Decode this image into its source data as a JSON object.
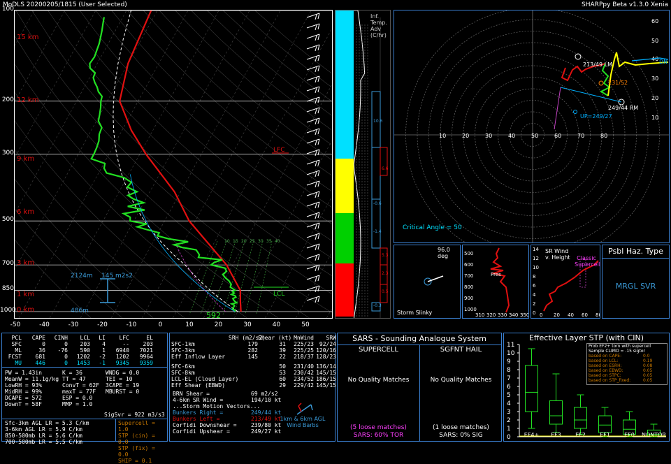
{
  "header": {
    "left": "MoDLS   20200205/1815  (User Selected)",
    "right": "SHARPpy Beta v1.3.0 Xenia"
  },
  "skewt": {
    "pressure_labels": [
      "100",
      "200",
      "300",
      "500",
      "700",
      "850",
      "1000"
    ],
    "height_labels": [
      "15 km",
      "12 km",
      "9 km",
      "6 km",
      "3 km",
      "1 km",
      "0 km"
    ],
    "temp_labels": [
      "-50",
      "-40",
      "-30",
      "-20",
      "-10",
      "0",
      "10",
      "20",
      "30",
      "40",
      "50"
    ],
    "lfc_label": "LFC",
    "lcl_label": "LCL",
    "srh_label": "145 m2s2",
    "height_a": "2124m",
    "height_b": "486m",
    "sfc_temp": "592",
    "hodo_mini_labels": [
      "10",
      "15",
      "20",
      "25",
      "30",
      "35",
      "40"
    ]
  },
  "adv": {
    "title": "Inf. Temp. Adv (C/hr)",
    "values": [
      "10.6",
      "-0.6",
      "-1.4",
      "5.3",
      "2.3",
      "0.5",
      "-0.3"
    ],
    "blue_values": [
      "10.6",
      "-0.6",
      "-1.4",
      "-0.3"
    ],
    "red_values": [
      "6.6",
      "5.3",
      "2.3",
      "0.5"
    ]
  },
  "hodograph": {
    "axis_labels": [
      "10",
      "20",
      "30",
      "40",
      "50",
      "60",
      "70",
      "80"
    ],
    "y_labels": [
      "60",
      "50",
      "40",
      "30",
      "20",
      "10"
    ],
    "lm_label": "213/49 LM",
    "rm_label": "249/44 RM",
    "up_label": "UP=249/27",
    "dn_label": "DN",
    "mw_label": "231/52",
    "critical_angle": "Critical Angle = 50"
  },
  "slinky": {
    "title": "Storm Slinky",
    "deg": "96.0 deg"
  },
  "theta": {
    "xlabels": [
      "310",
      "320",
      "330",
      "340",
      "350"
    ],
    "ylabels": [
      "500",
      "600",
      "700",
      "800",
      "900",
      "1000"
    ],
    "label": "Pres"
  },
  "srwind": {
    "title": "SR Wind v. Height",
    "classic": "Classic Supercell",
    "xlabels": [
      "0",
      "20",
      "40",
      "60",
      "80"
    ],
    "ylabels": [
      "14",
      "12",
      "10",
      "8",
      "6",
      "4",
      "2",
      "0"
    ]
  },
  "hazard": {
    "title": "Psbl Haz. Type",
    "value": "MRGL SVR"
  },
  "parcel_table": {
    "headers": [
      "PCL",
      "CAPE",
      "CINH",
      "LCL",
      "LI",
      "LFC",
      "EL"
    ],
    "rows": [
      [
        "SFC",
        "0",
        "0",
        "203",
        "4",
        "--",
        "203"
      ],
      [
        "ML",
        "36",
        "-76",
        "590",
        "1",
        "6940",
        "7021"
      ],
      [
        "FCST",
        "681",
        "0",
        "1202",
        "-2",
        "1202",
        "9964"
      ],
      [
        "MU",
        "446",
        "0",
        "1453",
        "-1",
        "9345",
        "9359"
      ]
    ]
  },
  "thermo": {
    "left": [
      "PW = 1.43in",
      "MeanW = 11.1g/kg",
      "LowRH = 93%",
      "MidRH = 99%",
      "DCAPE = 572",
      "DownT = 58F"
    ],
    "right": [
      "K = 36",
      "TT = 47",
      "ConvT = 62F",
      "maxT = 77F",
      "ESP = 0.0",
      "MMP = 1.0"
    ],
    "right2": [
      "WNDG = 0.0",
      "TEI = 10",
      "3CAPE = 19",
      "MBURST = 0",
      "",
      ""
    ],
    "sigsvr": "SigSvr = 922 m3/s3",
    "lapse": [
      "Sfc-3km AGL LR = 5.3 C/km",
      "3-6km AGL LR = 5.9 C/km",
      "850-500mb LR = 5.6 C/km",
      "700-500mb LR = 5.5 C/km"
    ],
    "composite": [
      "Supercell = 1.0",
      "STP (cin) = 0.0",
      "STP (fix) = 0.0",
      "SHIP = 0.1"
    ]
  },
  "kinematic": {
    "headers": [
      "",
      "SRH (m2/s2)",
      "Shear (kt)",
      "MnWind",
      "SRW"
    ],
    "rows": [
      [
        "SFC-1km",
        "179",
        "31",
        "225/23",
        "92/24"
      ],
      [
        "SFC-3km",
        "282",
        "39",
        "225/25",
        "120/16"
      ],
      [
        "Eff Inflow Layer",
        "145",
        "22",
        "218/37",
        "128/23"
      ],
      [
        "SFC-6km",
        "",
        "50",
        "231/40",
        "136/14"
      ],
      [
        "SFC-8km",
        "",
        "53",
        "230/42",
        "145/15"
      ],
      [
        "LCL-EL (Cloud Layer)",
        "",
        "60",
        "234/52",
        "186/15"
      ],
      [
        "Eff Shear (EBWD)",
        "",
        "29",
        "229/42",
        "145/15"
      ]
    ],
    "brn_shear": "BRN Shear =",
    "brn_value": "69 m2/s2",
    "sr46": "4-6km SR Wind =",
    "sr46_value": "194/10 kt",
    "motion_title": "...Storm Motion Vectors...",
    "motions": [
      [
        "Bunkers Right =",
        "249/44 kt"
      ],
      [
        "Bunkers Left =",
        "213/49 kt"
      ],
      [
        "Corfidi Downshear =",
        "239/80 kt"
      ],
      [
        "Corfidi Upshear =",
        "249/27 kt"
      ]
    ],
    "barb_legend": "1km & 6km AGL Wind Barbs"
  },
  "sars": {
    "title": "SARS - Sounding Analogue System",
    "supercell": "SUPERCELL",
    "hail": "SGFNT HAIL",
    "no_match_1": "No Quality Matches",
    "no_match_2": "No Quality Matches",
    "loose_1": "(5 loose matches)",
    "loose_1b": "SARS: 60% TOR",
    "loose_2": "(1 loose matches)",
    "loose_2b": "SARS: 0% SIG"
  },
  "stp": {
    "title": "Effective Layer STP (with CIN)",
    "legend_title": "Prob EF2+ torn with supercell",
    "legend_sub": "Sample CLIMO = .15 sigtor",
    "legend_rows": [
      [
        "based on CAPE:",
        "0.0"
      ],
      [
        "based on LCL:",
        "0.19"
      ],
      [
        "based on ESRH:",
        "0.08"
      ],
      [
        "based on EBWD:",
        "0.05"
      ],
      [
        "based on STPC:",
        "0.05"
      ],
      [
        "based on STP_fixed:",
        "0.05"
      ]
    ],
    "y_ticks": [
      "11",
      "10",
      "9",
      "8",
      "7",
      "6",
      "5",
      "4",
      "3",
      "2",
      "1",
      "0"
    ],
    "categories": [
      "EF4+",
      "EF3",
      "EF2",
      "EF1",
      "EF0",
      "NONTOR"
    ]
  },
  "chart_data": {
    "type": "box",
    "title": "Effective Layer STP (with CIN)",
    "categories": [
      "EF4+",
      "EF3",
      "EF2",
      "EF1",
      "EF0",
      "NONTOR"
    ],
    "boxes": [
      {
        "low": 1.0,
        "q1": 3.0,
        "median": 5.3,
        "q3": 8.5,
        "high": 10.5
      },
      {
        "low": 0.5,
        "q1": 1.5,
        "median": 2.5,
        "q3": 4.3,
        "high": 7.5
      },
      {
        "low": 0.3,
        "q1": 1.0,
        "median": 2.0,
        "q3": 3.5,
        "high": 5.0
      },
      {
        "low": 0.0,
        "q1": 0.5,
        "median": 1.4,
        "q3": 2.5,
        "high": 3.5
      },
      {
        "low": 0.0,
        "q1": 0.3,
        "median": 0.9,
        "q3": 2.0,
        "high": 3.0
      },
      {
        "low": 0.0,
        "q1": 0.1,
        "median": 0.3,
        "q3": 0.8,
        "high": 1.5
      }
    ],
    "ylim": [
      0,
      11
    ],
    "current_value": 0.0,
    "skewt_temperature_C": [
      {
        "p": 1000,
        "t": 21
      },
      {
        "p": 925,
        "t": 19
      },
      {
        "p": 850,
        "t": 17
      },
      {
        "p": 700,
        "t": 8
      },
      {
        "p": 500,
        "t": -12
      },
      {
        "p": 400,
        "t": -22
      },
      {
        "p": 300,
        "t": -38
      },
      {
        "p": 250,
        "t": -47
      },
      {
        "p": 200,
        "t": -56
      },
      {
        "p": 150,
        "t": -60
      },
      {
        "p": 100,
        "t": -62
      }
    ],
    "skewt_dewpoint_C": [
      {
        "p": 1000,
        "t": 19
      },
      {
        "p": 925,
        "t": 17
      },
      {
        "p": 850,
        "t": 15
      },
      {
        "p": 700,
        "t": 6
      },
      {
        "p": 600,
        "t": -10
      },
      {
        "p": 500,
        "t": -30
      },
      {
        "p": 400,
        "t": -35
      },
      {
        "p": 300,
        "t": -54
      },
      {
        "p": 200,
        "t": -62
      },
      {
        "p": 150,
        "t": -72
      },
      {
        "p": 100,
        "t": -77
      }
    ]
  }
}
